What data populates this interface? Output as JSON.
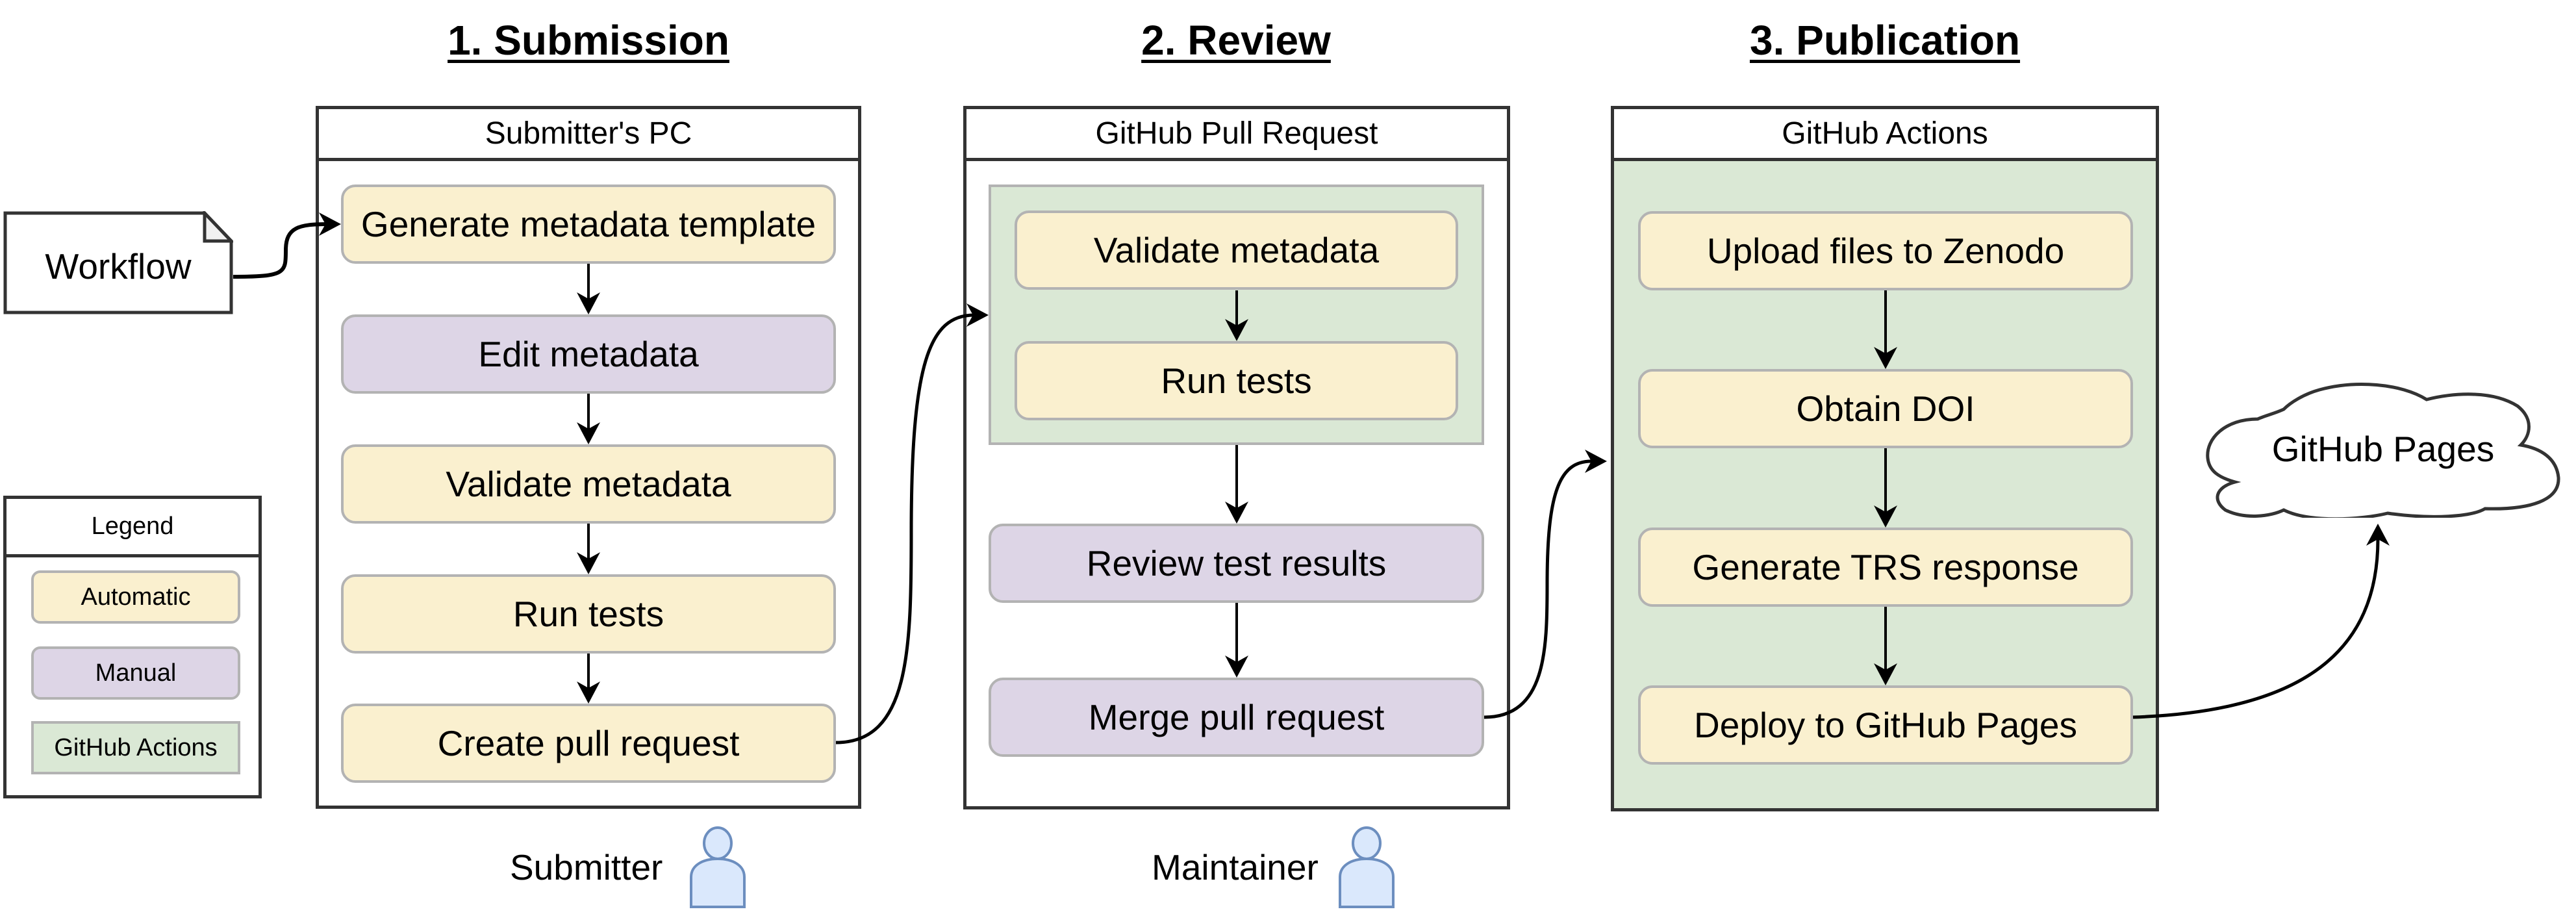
{
  "phases": {
    "submission": "1. Submission",
    "review": "2. Review",
    "publication": "3. Publication"
  },
  "workflow_doc": {
    "label": "Workflow"
  },
  "submitter_pc": {
    "title": "Submitter's PC",
    "steps": [
      {
        "label": "Generate metadata template",
        "kind": "automatic"
      },
      {
        "label": "Edit metadata",
        "kind": "manual"
      },
      {
        "label": "Validate metadata",
        "kind": "automatic"
      },
      {
        "label": "Run tests",
        "kind": "automatic"
      },
      {
        "label": "Create pull request",
        "kind": "automatic"
      }
    ]
  },
  "pull_request": {
    "title": "GitHub Pull Request",
    "actions_group": [
      {
        "label": "Validate metadata",
        "kind": "automatic"
      },
      {
        "label": "Run tests",
        "kind": "automatic"
      }
    ],
    "steps": [
      {
        "label": "Review test results",
        "kind": "manual"
      },
      {
        "label": "Merge pull request",
        "kind": "manual"
      }
    ]
  },
  "github_actions": {
    "title": "GitHub Actions",
    "steps": [
      {
        "label": "Upload files to Zenodo",
        "kind": "automatic"
      },
      {
        "label": "Obtain DOI",
        "kind": "automatic"
      },
      {
        "label": "Generate TRS response",
        "kind": "automatic"
      },
      {
        "label": "Deploy to GitHub Pages",
        "kind": "automatic"
      }
    ]
  },
  "github_pages": {
    "label": "GitHub Pages"
  },
  "actors": {
    "submitter": "Submitter",
    "maintainer": "Maintainer"
  },
  "legend": {
    "title": "Legend",
    "items": [
      {
        "label": "Automatic",
        "color": "#faf0cf"
      },
      {
        "label": "Manual",
        "color": "#ddd5e6"
      },
      {
        "label": "GitHub Actions",
        "color": "#dae8d5"
      }
    ]
  },
  "colors": {
    "automatic": "#faf0cf",
    "manual": "#ddd5e6",
    "github_actions": "#dae8d5",
    "actor_fill": "#dae8fc",
    "actor_stroke": "#6c8ebf"
  }
}
